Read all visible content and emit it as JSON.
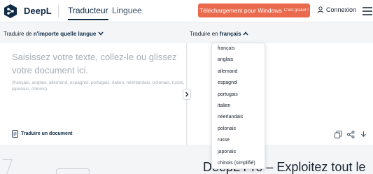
{
  "header": {
    "brand": "DeepL",
    "tabs": [
      "Traducteur",
      "Linguee"
    ],
    "download_label": "Téléchargement pour Windows",
    "download_badge": "C'est gratuit !",
    "login_label": "Connexion"
  },
  "source": {
    "prefix": "Traduire de ",
    "lang": "n'importe quelle langue",
    "placeholder": "Saisissez votre texte, collez-le ou glissez votre document ici.",
    "hint": "(français, anglais, allemand, espagnol, portugais, italien, néerlandais, polonais, russe, japonais, chinois)",
    "doc_label": "Traduire un document"
  },
  "target": {
    "prefix": "Traduire en ",
    "lang": "français"
  },
  "dropdown": {
    "items": [
      "français",
      "anglais",
      "allemand",
      "espagnol",
      "portugais",
      "italien",
      "néerlandais",
      "polonais",
      "russe",
      "japonais",
      "chinois (simplifié)"
    ]
  },
  "promo": {
    "text": "DeepL Pro – Exploitez tout le"
  },
  "colors": {
    "accent": "#ea6a4e",
    "brand_dark": "#0f2b46"
  },
  "icons": [
    "deepl-logo-icon",
    "user-icon",
    "menu-icon",
    "chevron-down-icon",
    "chevron-up-icon",
    "document-icon",
    "chevron-right-icon",
    "copy-icon",
    "share-icon",
    "download-icon"
  ]
}
